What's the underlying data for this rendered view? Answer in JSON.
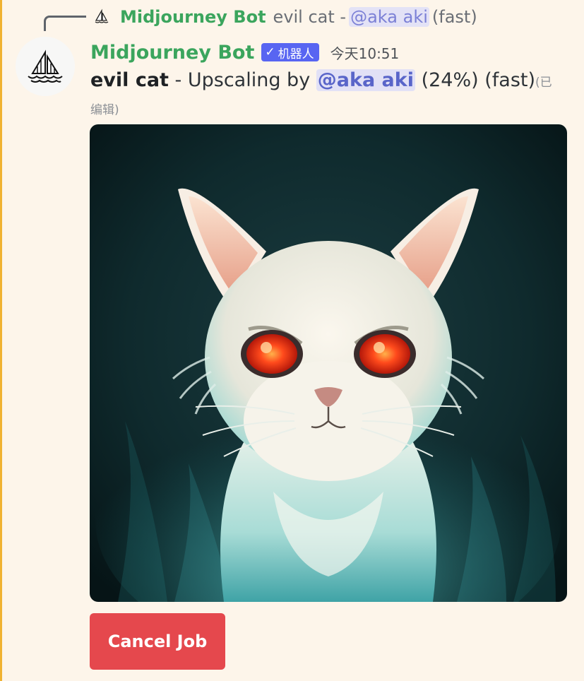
{
  "reply": {
    "author": "Midjourney Bot",
    "text": "evil cat - ",
    "mention": "@aka aki",
    "suffix": " (fast)"
  },
  "header": {
    "author": "Midjourney Bot",
    "badge_label": "机器人",
    "timestamp": "今天10:51"
  },
  "message": {
    "prompt": "evil cat",
    "separator": " - Upscaling by ",
    "mention": "@aka aki",
    "progress": " (24%) (fast)",
    "edited": "(已编辑)"
  },
  "actions": {
    "cancel_label": "Cancel Job"
  },
  "colors": {
    "background": "#fdf5ea",
    "author": "#3ba55d",
    "badge": "#5865f2",
    "mention": "#5965c9",
    "cancel": "#e5484d",
    "accent_bar": "#f0b232"
  },
  "icons": {
    "reply_avatar": "sailboat-icon",
    "avatar": "sailboat-icon",
    "badge": "checkmark-icon"
  }
}
